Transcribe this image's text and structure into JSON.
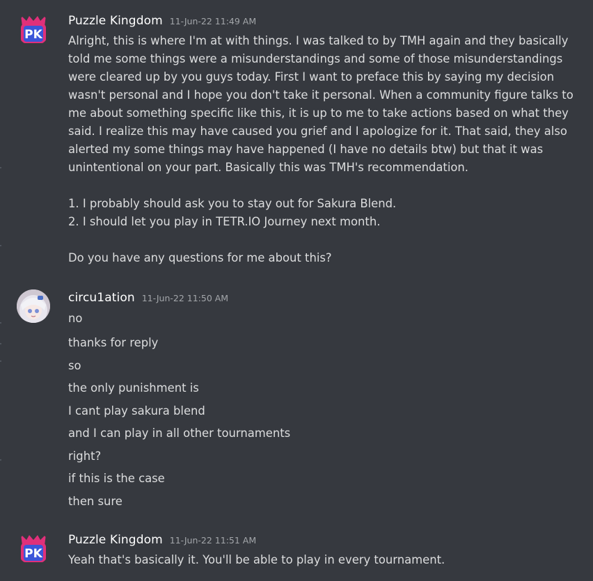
{
  "messages": [
    {
      "username": "Puzzle Kingdom",
      "timestamp": "11-Jun-22 11:49 AM",
      "paragraphs": [
        "Alright, this is where I'm at with things. I was talked to by TMH again and they basically told me some things were a misunderstandings and some of those misunderstandings were cleared up by you guys today. First I want to preface this by saying my decision wasn't personal and I hope you don't take it personal. When a community figure talks to me about something specific like this, it is up to me to take actions based on what they said. I realize this may have caused you grief and I apologize for it. That said, they also alerted my some things may have happened (I have no details btw) but that it was unintentional on your part. Basically this was TMH's recommendation.",
        "1. I probably should ask you to stay out for Sakura Blend.",
        "2. I should let you play in TETR.IO Journey next month.",
        "Do you have any questions for me about this?"
      ]
    },
    {
      "username": "circu1ation",
      "timestamp": "11-Jun-22 11:50 AM",
      "lines": [
        "no",
        "thanks for reply",
        "so",
        "the only punishment is",
        "I cant play sakura blend",
        "and I can play in all other tournaments",
        "right?",
        "if this is the case",
        "then sure"
      ]
    },
    {
      "username": "Puzzle Kingdom",
      "timestamp": "11-Jun-22 11:51 AM",
      "lines": [
        "Yeah that's basically it. You'll be able to play in every tournament."
      ]
    }
  ],
  "colors": {
    "background": "#36393f",
    "username": "#ffffff",
    "text": "#dcddde",
    "timestamp": "#a3a6aa",
    "pk_magenta": "#e0307a",
    "pk_blue": "#3b55d9"
  },
  "icons": {
    "pk_avatar": "puzzle-kingdom-logo-icon",
    "circ_avatar": "anime-girl-avatar-icon"
  }
}
